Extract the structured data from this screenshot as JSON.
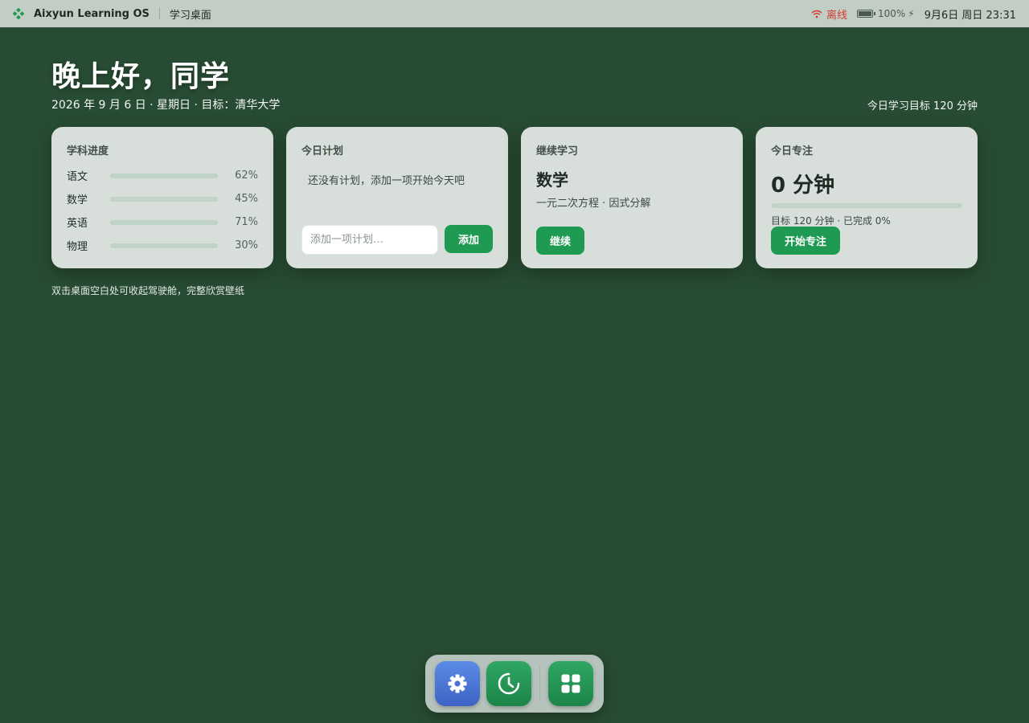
{
  "topbar": {
    "app_name": "Aixyun Learning OS",
    "breadcrumb": "学习桌面",
    "network_status": "离线",
    "battery": "100%",
    "charging_symbol": "⚡",
    "clock": "9月6日 周日 23:31",
    "icons": {
      "logo": "app-logo-icon",
      "wifi": "wifi-off-icon",
      "battery": "battery-icon"
    },
    "colors": {
      "offline": "#d23b30"
    }
  },
  "header": {
    "greeting": "晚上好，同学",
    "subline": "2026 年 9 月 6 日 · 星期日 · 目标：清华大学",
    "daily_goal": "今日学习目标 120 分钟"
  },
  "cards": {
    "progress": {
      "title": "学科进度",
      "subjects": [
        {
          "name": "语文",
          "percent_label": "62%",
          "value": 0.62
        },
        {
          "name": "数学",
          "percent_label": "45%",
          "value": 0.45
        },
        {
          "name": "英语",
          "percent_label": "71%",
          "value": 0.71
        },
        {
          "name": "物理",
          "percent_label": "30%",
          "value": 0.3
        }
      ]
    },
    "plan": {
      "title": "今日计划",
      "empty_text": "还没有计划，添加一项开始今天吧",
      "input_placeholder": "添加一项计划…",
      "input_value": "",
      "add_label": "添加"
    },
    "continue": {
      "title": "继续学习",
      "subject": "数学",
      "topic": "一元二次方程 · 因式分解",
      "button_label": "继续"
    },
    "focus": {
      "title": "今日专注",
      "value": "0 分钟",
      "progress": 0,
      "meta": "目标 120 分钟 · 已完成 0%",
      "button_label": "开始专注"
    }
  },
  "hint": "双击桌面空白处可收起驾驶舱，完整欣赏壁纸",
  "dock": {
    "apps": [
      {
        "name": "settings",
        "icon": "gear-icon"
      },
      {
        "name": "clock",
        "icon": "clock-icon"
      },
      {
        "name": "apps",
        "icon": "grid-icon"
      }
    ]
  },
  "theme": {
    "accent": "#1f9a52",
    "wallpaper": "#284c33"
  }
}
